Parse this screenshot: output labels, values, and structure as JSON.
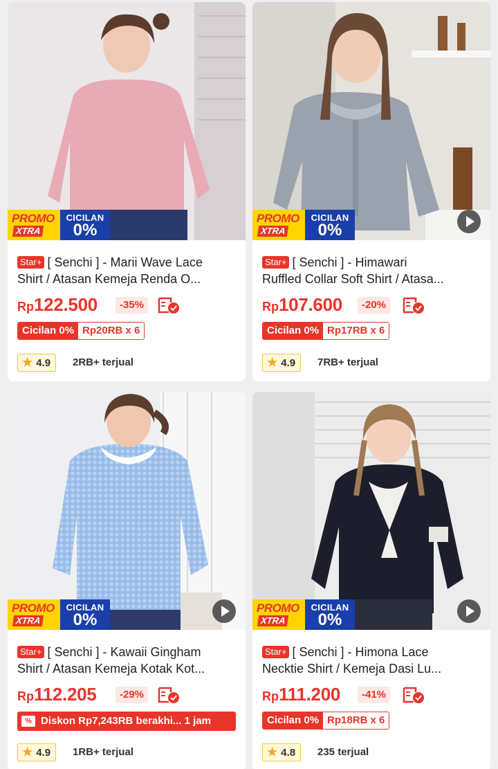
{
  "products": [
    {
      "badge": "Star+",
      "title_line1": "[ Senchi ] - Marii Wave Lace",
      "title_line2": "Shirt  / Atasan Kemeja Renda O...",
      "currency": "Rp",
      "price": "122.500",
      "discount": "-35%",
      "cicilan_label": "Cicilan 0%",
      "cicilan_plan": "Rp20RB x 6",
      "rating": "4.9",
      "sold": "2RB+ terjual",
      "promo_top": "PROMO",
      "promo_bottom": "XTRA",
      "cil_top": "CICILAN",
      "cil_bottom": "0%",
      "shirt_color": "#e8aab5",
      "bg_color": "#ece8ea",
      "has_video": false
    },
    {
      "badge": "Star+",
      "title_line1": "[ Senchi ] - Himawari",
      "title_line2": "Ruffled Collar Soft Shirt / Atasa...",
      "currency": "Rp",
      "price": "107.600",
      "discount": "-20%",
      "cicilan_label": "Cicilan 0%",
      "cicilan_plan": "Rp17RB x 6",
      "rating": "4.9",
      "sold": "7RB+ terjual",
      "promo_top": "PROMO",
      "promo_bottom": "XTRA",
      "cil_top": "CICILAN",
      "cil_bottom": "0%",
      "shirt_color": "#9aa2ae",
      "bg_color": "#e4e2dd",
      "has_video": true
    },
    {
      "badge": "Star+",
      "title_line1": "[ Senchi ] - Kawaii Gingham",
      "title_line2": "Shirt / Atasan Kemeja Kotak Kot...",
      "currency": "Rp",
      "price": "112.205",
      "discount": "-29%",
      "diskon_text": "Diskon Rp7,243RB berakhi... 1 jam",
      "diskon_icon": "%",
      "rating": "4.9",
      "sold": "1RB+ terjual",
      "promo_top": "PROMO",
      "promo_bottom": "XTRA",
      "cil_top": "CICILAN",
      "cil_bottom": "0%",
      "shirt_color": "#9ec2ee",
      "bg_color": "#eeeef0",
      "has_video": true
    },
    {
      "badge": "Star+",
      "title_line1": "[ Senchi ] - Himona Lace",
      "title_line2": "Necktie Shirt  / Kemeja Dasi Lu...",
      "currency": "Rp",
      "price": "111.200",
      "discount": "-41%",
      "cicilan_label": "Cicilan 0%",
      "cicilan_plan": "Rp18RB x 6",
      "rating": "4.8",
      "sold": "235 terjual",
      "promo_top": "PROMO",
      "promo_bottom": "XTRA",
      "cil_top": "CICILAN",
      "cil_bottom": "0%",
      "shirt_color": "#1c1f2b",
      "bg_color": "#dcdcdc",
      "has_video": true
    }
  ],
  "colors": {
    "accent": "#e8352a",
    "promo_yellow": "#ffd400",
    "cicilan_blue": "#1a3fa8"
  }
}
